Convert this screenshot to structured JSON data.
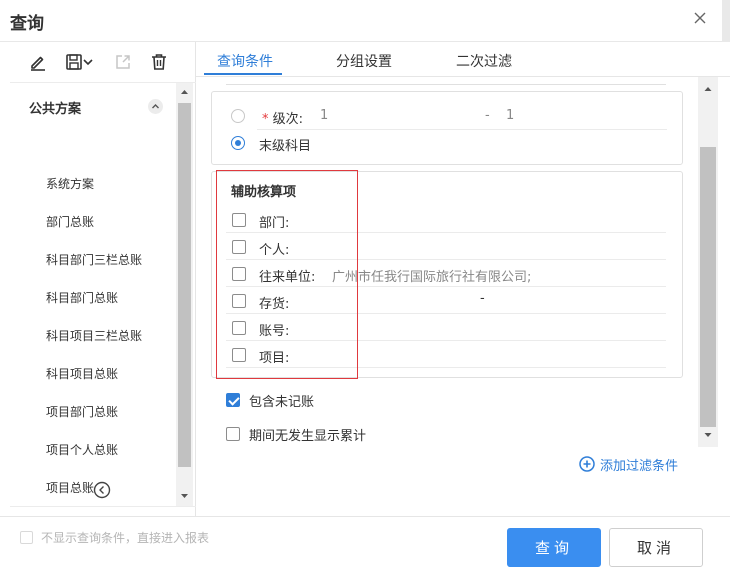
{
  "window": {
    "title": "查询"
  },
  "toolbar": {
    "icons": [
      "edit-icon",
      "save-icon",
      "chevron-down-icon",
      "export-icon",
      "trash-icon"
    ]
  },
  "scheme_list": {
    "group_label": "公共方案",
    "items": [
      "系统方案",
      "部门总账",
      "科目部门三栏总账",
      "科目部门总账",
      "科目项目三栏总账",
      "科目项目总账",
      "项目部门总账",
      "项目个人总账",
      "项目总账"
    ]
  },
  "tabs": [
    {
      "label": "查询条件",
      "active": true
    },
    {
      "label": "分组设置",
      "active": false
    },
    {
      "label": "二次过滤",
      "active": false
    }
  ],
  "account_level": {
    "row1_label": "级次:",
    "row1_required_mark": "*",
    "row1_from": "1",
    "row1_separator": "-",
    "row1_to": "1",
    "row1_selected": false,
    "row2_label": "末级科目",
    "row2_selected": true
  },
  "aux_section": {
    "title": "辅助核算项",
    "items": [
      {
        "label": "部门:",
        "checked": false,
        "value": ""
      },
      {
        "label": "个人:",
        "checked": false,
        "value": ""
      },
      {
        "label": "往来单位:",
        "checked": false,
        "value": "广州市任我行国际旅行社有限公司;"
      },
      {
        "label": "存货:",
        "checked": false,
        "value": "-"
      },
      {
        "label": "账号:",
        "checked": false,
        "value": ""
      },
      {
        "label": "项目:",
        "checked": false,
        "value": ""
      }
    ]
  },
  "options": {
    "include_unposted": {
      "label": "包含未记账",
      "checked": true
    },
    "show_cumulative": {
      "label": "期间无发生显示累计",
      "checked": false
    }
  },
  "add_filter": {
    "label": "添加过滤条件"
  },
  "footer": {
    "skip_conditions_label": "不显示查询条件，直接进入报表",
    "query_button": "查询",
    "cancel_button": "取消"
  },
  "colors": {
    "accent": "#2f7ed8",
    "primary_button": "#3a8ef0",
    "highlight_frame": "#e0393e",
    "required_mark": "#e4393c"
  }
}
